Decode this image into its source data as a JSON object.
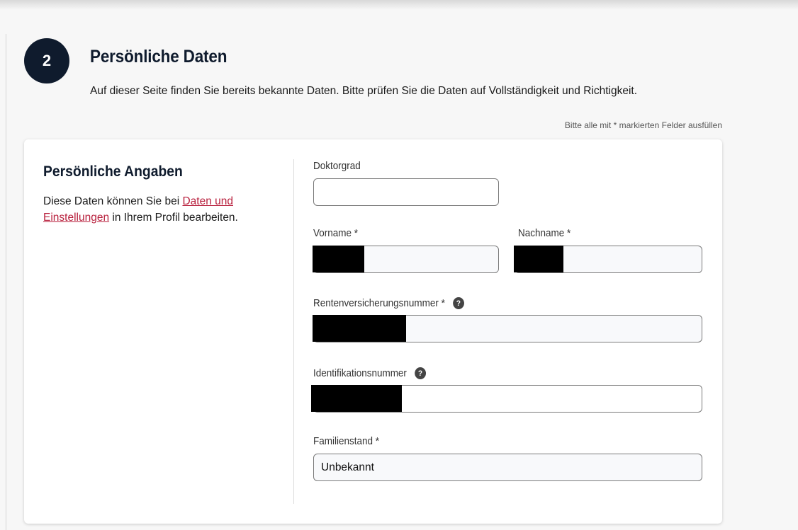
{
  "step": {
    "number": "2",
    "title": "Persönliche Daten",
    "description": "Auf dieser Seite finden Sie bereits bekannte Daten. Bitte prüfen Sie die Daten auf Vollständigkeit und Richtigkeit.",
    "required_note": "Bitte alle mit * markierten Felder ausfüllen"
  },
  "section": {
    "title": "Persönliche Angaben",
    "desc_before": "Diese Daten können Sie bei ",
    "link_text": "Daten und Einstellungen",
    "desc_after": " in Ihrem Profil bearbeiten."
  },
  "fields": {
    "doktorgrad": {
      "label": "Doktorgrad",
      "value": ""
    },
    "vorname": {
      "label": "Vorname *",
      "value": ""
    },
    "nachname": {
      "label": "Nachname *",
      "value": ""
    },
    "rvnr": {
      "label": "Rentenversicherungsnummer *",
      "value": ""
    },
    "idnr": {
      "label": "Identifikationsnummer",
      "value": ""
    },
    "familienstand": {
      "label": "Familienstand *",
      "value": "Unbekannt"
    }
  },
  "icons": {
    "help": "?"
  }
}
